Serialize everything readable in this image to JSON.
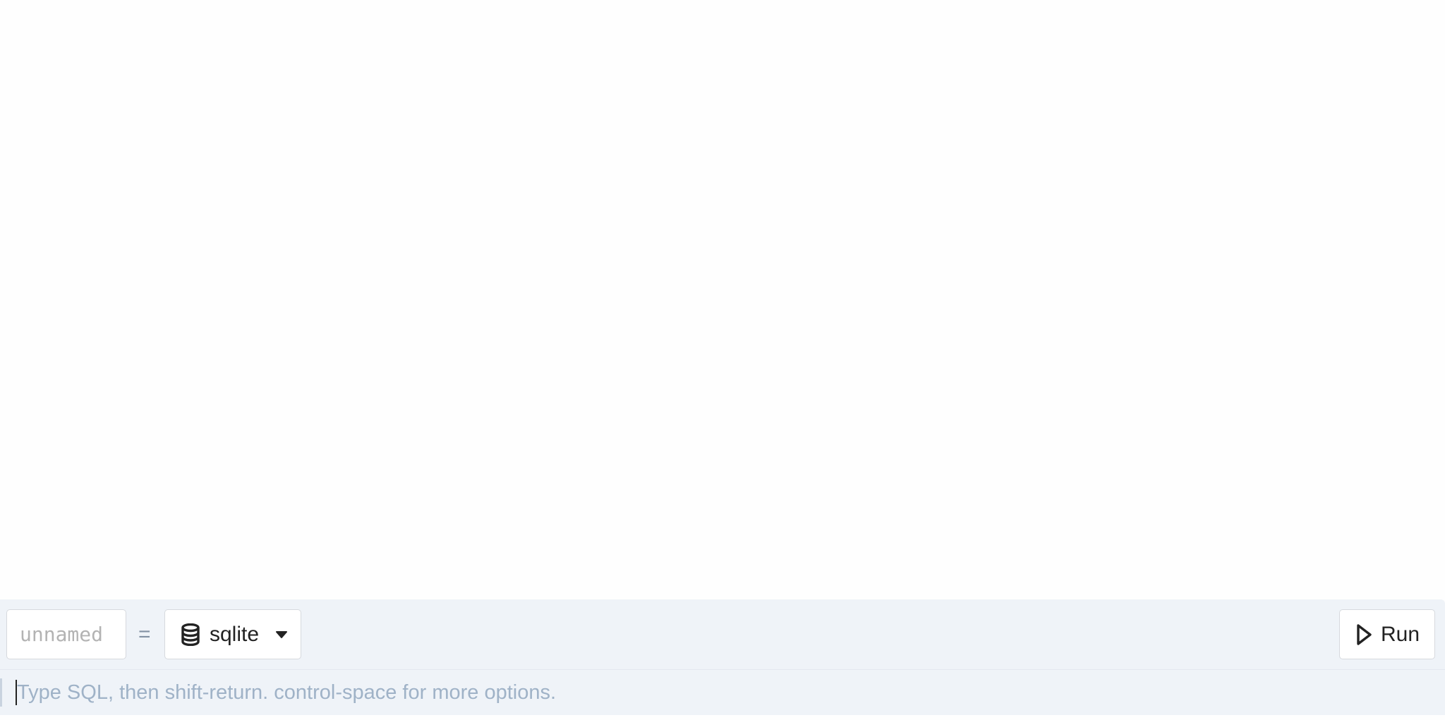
{
  "cell": {
    "name_input": {
      "value": "",
      "placeholder": "unnamed"
    },
    "equals_sign": "=",
    "database": {
      "icon": "database-icon",
      "selected": "sqlite",
      "dropdown_icon": "caret-down-icon"
    },
    "run_button": {
      "icon": "play-icon",
      "label": "Run"
    },
    "editor": {
      "value": "",
      "placeholder": "Type SQL, then shift-return. control-space for more options."
    }
  },
  "colors": {
    "cell_background": "#eff3f8",
    "page_background": "#fefefe",
    "placeholder_text": "#9fb2c7",
    "border": "#d6d9de"
  }
}
